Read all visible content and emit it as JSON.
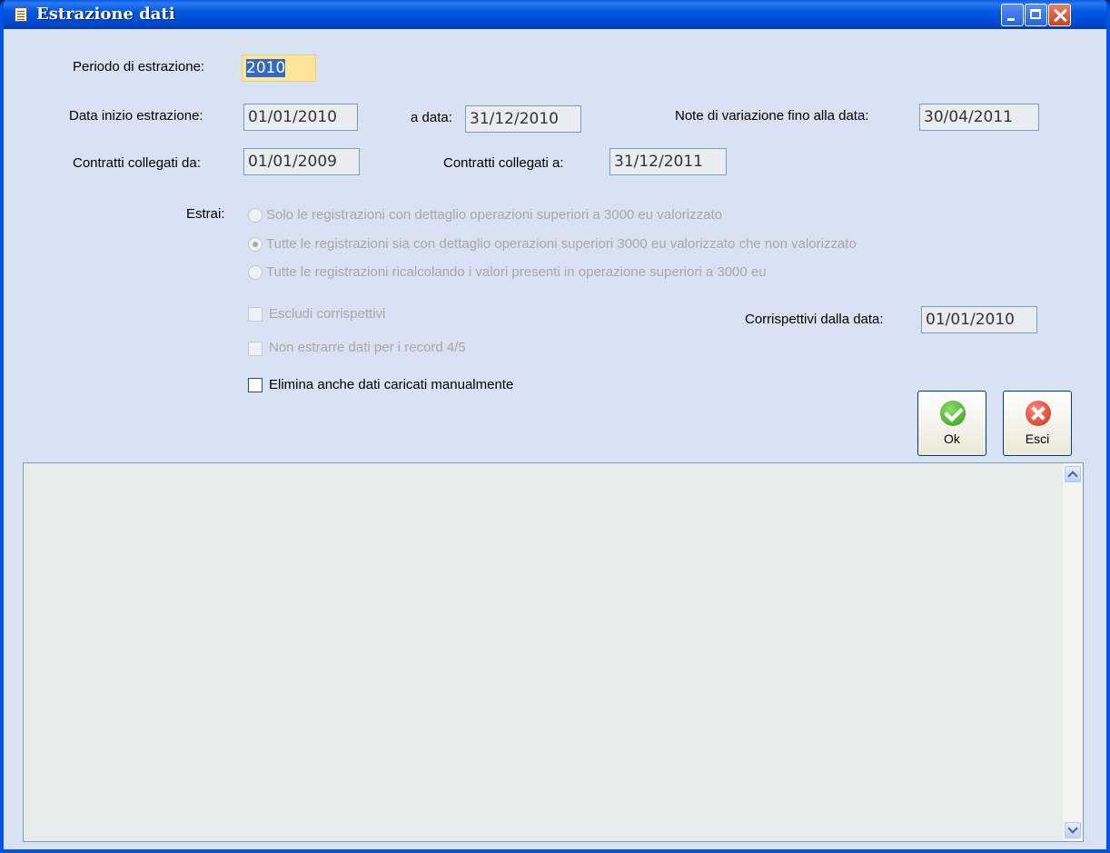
{
  "window": {
    "title": "Estrazione dati"
  },
  "form": {
    "periodo": {
      "label": "Periodo di estrazione:",
      "value": "2010"
    },
    "data_inizio": {
      "label": "Data inizio estrazione:",
      "value": "01/01/2010"
    },
    "a_data": {
      "label": "a data:",
      "value": "31/12/2010"
    },
    "note_variazione": {
      "label": "Note di variazione fino alla data:",
      "value": "30/04/2011"
    },
    "contratti_da": {
      "label": "Contratti collegati da:",
      "value": "01/01/2009"
    },
    "contratti_a": {
      "label": "Contratti collegati a:",
      "value": "31/12/2011"
    },
    "estrai": {
      "label": "Estrai:",
      "options": [
        "Solo le registrazioni con dettaglio operazioni superiori a 3000 eu valorizzato",
        "Tutte le registrazioni sia con dettaglio operazioni superiori 3000 eu valorizzato che non valorizzato",
        "Tutte le registrazioni ricalcolando i valori presenti in operazione superiori a 3000 eu"
      ],
      "selected_index": 1
    },
    "escludi_corrispettivi": {
      "label": "Escludi corrispettivi",
      "checked": false
    },
    "corrispettivi_data": {
      "label": "Corrispettivi dalla data:",
      "value": "01/01/2010"
    },
    "non_estrarre": {
      "label": "Non estrarre dati per i record 4/5",
      "checked": false
    },
    "elimina_manuali": {
      "label": "Elimina anche dati caricati manualmente",
      "checked": false
    }
  },
  "buttons": {
    "ok": "Ok",
    "esci": "Esci"
  },
  "colors": {
    "titlebar": "#0054e3",
    "background": "#d8e2f2",
    "active_field": "#fce49a"
  }
}
